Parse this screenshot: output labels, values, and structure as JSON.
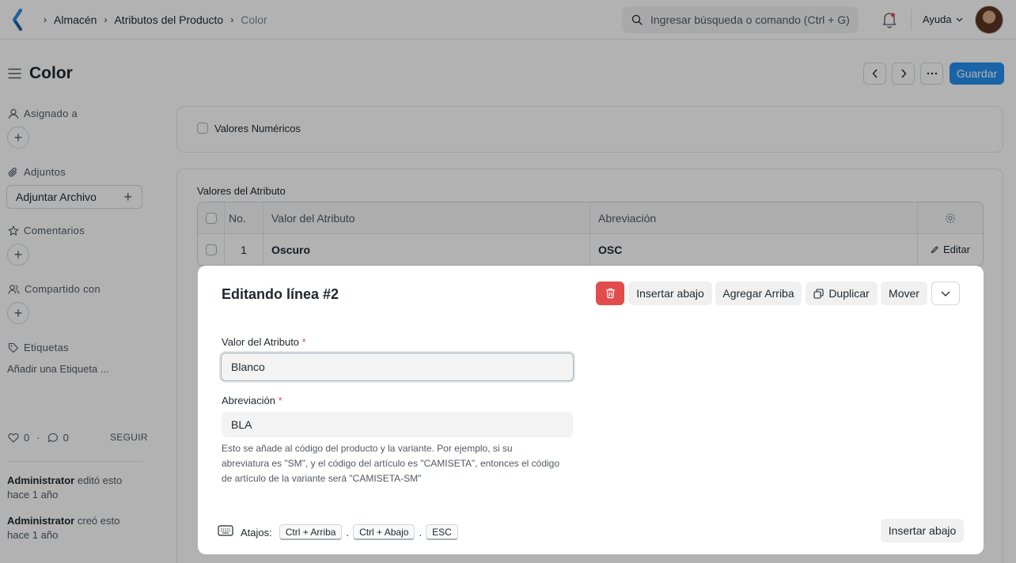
{
  "navbar": {
    "breadcrumbs": [
      "Almacén",
      "Atributos del Producto",
      "Color"
    ],
    "search_placeholder": "Ingresar búsqueda o comando (Ctrl + G)",
    "help_label": "Ayuda"
  },
  "page": {
    "title": "Color",
    "save_label": "Guardar"
  },
  "sidebar": {
    "assigned_label": "Asignado a",
    "attachments_label": "Adjuntos",
    "attach_button": "Adjuntar Archivo",
    "comments_label": "Comentarios",
    "shared_label": "Compartido con",
    "tags_label": "Etiquetas",
    "tag_placeholder": "Añadir una Etiqueta ...",
    "likes_count": "0",
    "dot": "·",
    "comments_count": "0",
    "follow_label": "SEGUIR",
    "activity": [
      {
        "user": "Administrator",
        "text": "editó esto",
        "time": "hace 1 año"
      },
      {
        "user": "Administrator",
        "text": "creó esto",
        "time": "hace 1 año"
      }
    ]
  },
  "form": {
    "numeric_values_label": "Valores Numéricos",
    "table_label": "Valores del Atributo",
    "table_headers": {
      "no": "No.",
      "value": "Valor del Atributo",
      "abbr": "Abreviación"
    },
    "rows": [
      {
        "no": "1",
        "value": "Oscuro",
        "abbr": "OSC",
        "action": "Editar"
      }
    ]
  },
  "modal": {
    "title": "Editando línea #2",
    "buttons": {
      "insert_below": "Insertar abajo",
      "add_above": "Agregar Arriba",
      "duplicate": "Duplicar",
      "move": "Mover"
    },
    "fields": {
      "value_label": "Valor del Atributo",
      "value": "Blanco",
      "abbr_label": "Abreviación",
      "abbr": "BLA",
      "required_mark": "*",
      "abbr_description": "Esto se añade al código del producto y la variante. Por ejemplo, si su abreviatura es \"SM\", y el código del artículo es \"CAMISETA\", entonces el código de artículo de la variante será \"CAMISETA-SM\""
    },
    "shortcuts_label": "Atajos:",
    "shortcuts": [
      "Ctrl + Arriba",
      "Ctrl + Abajo",
      "ESC"
    ],
    "shortcut_sep": ".",
    "footer_insert_below": "Insertar abajo"
  },
  "colors": {
    "primary": "#2490ef",
    "danger": "#e24c4c",
    "overlay": "rgba(0,0,0,0.3)"
  }
}
